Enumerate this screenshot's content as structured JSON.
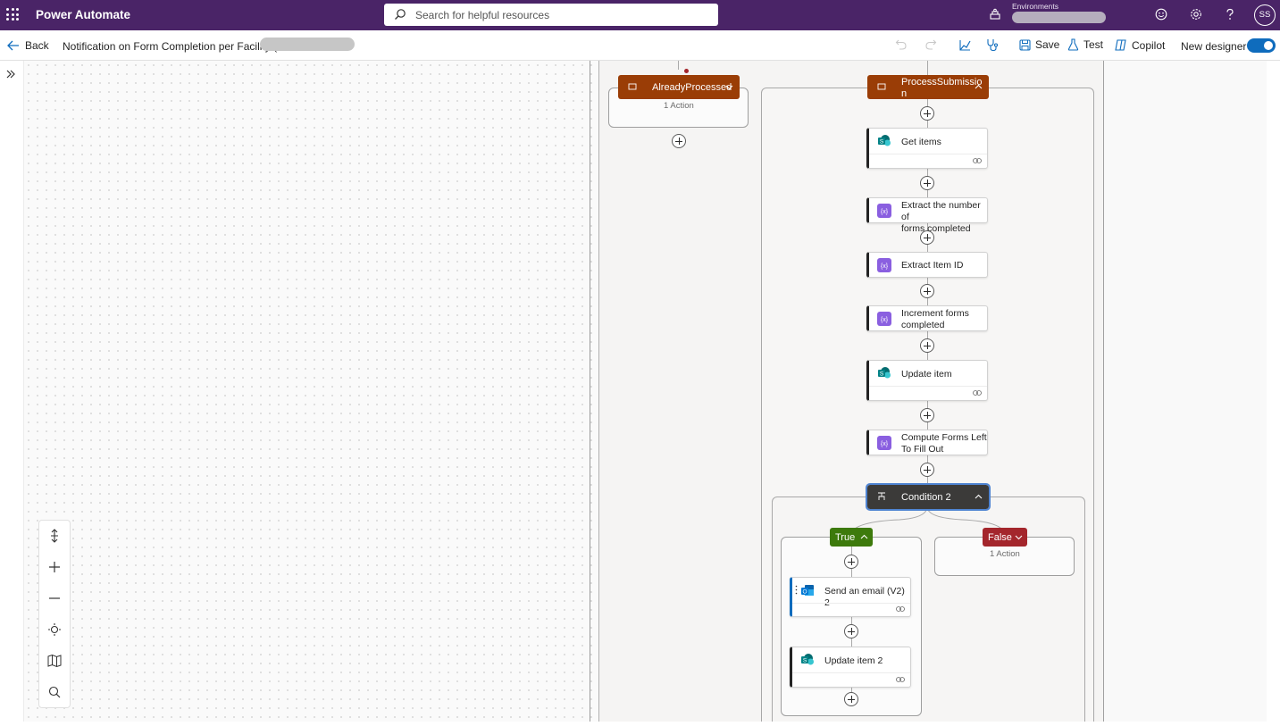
{
  "topbar": {
    "app_name": "Power Automate",
    "search_placeholder": "Search for helpful resources",
    "environments_label": "Environments",
    "avatar_initials": "SS"
  },
  "cmdbar": {
    "back_label": "Back",
    "flow_name": "Notification on Form Completion per Facility (",
    "save_label": "Save",
    "test_label": "Test",
    "copilot_label": "Copilot",
    "new_designer_label": "New designer",
    "new_designer_on": true
  },
  "flow": {
    "already_processed": {
      "title": "AlreadyProcessed",
      "count": "1 Action"
    },
    "process_submission": {
      "title": "ProcessSubmissio",
      "title_wrap": "n"
    },
    "actions": [
      {
        "title": "Get items",
        "type": "sharepoint"
      },
      {
        "title": "Extract the number of",
        "title2": "forms completed",
        "type": "variable"
      },
      {
        "title": "Extract Item ID",
        "type": "variable"
      },
      {
        "title": "Increment forms",
        "title2": "completed",
        "type": "variable"
      },
      {
        "title": "Update item",
        "type": "sharepoint"
      },
      {
        "title": "Compute Forms Left",
        "title2": "To Fill Out",
        "type": "variable"
      }
    ],
    "condition": {
      "title": "Condition 2"
    },
    "true_branch": {
      "label": "True",
      "actions": [
        {
          "title": "Send an email (V2) 2",
          "type": "outlook"
        },
        {
          "title": "Update item 2",
          "type": "sharepoint"
        }
      ]
    },
    "false_branch": {
      "label": "False",
      "count": "1 Action"
    }
  },
  "colors": {
    "topbar": "#4a2467",
    "scope_header": "#9a3d06",
    "condition_header": "#3b3a39",
    "true_header": "#3d7a0c",
    "false_header": "#a4262c",
    "toggle_on": "#0f6cbd"
  }
}
